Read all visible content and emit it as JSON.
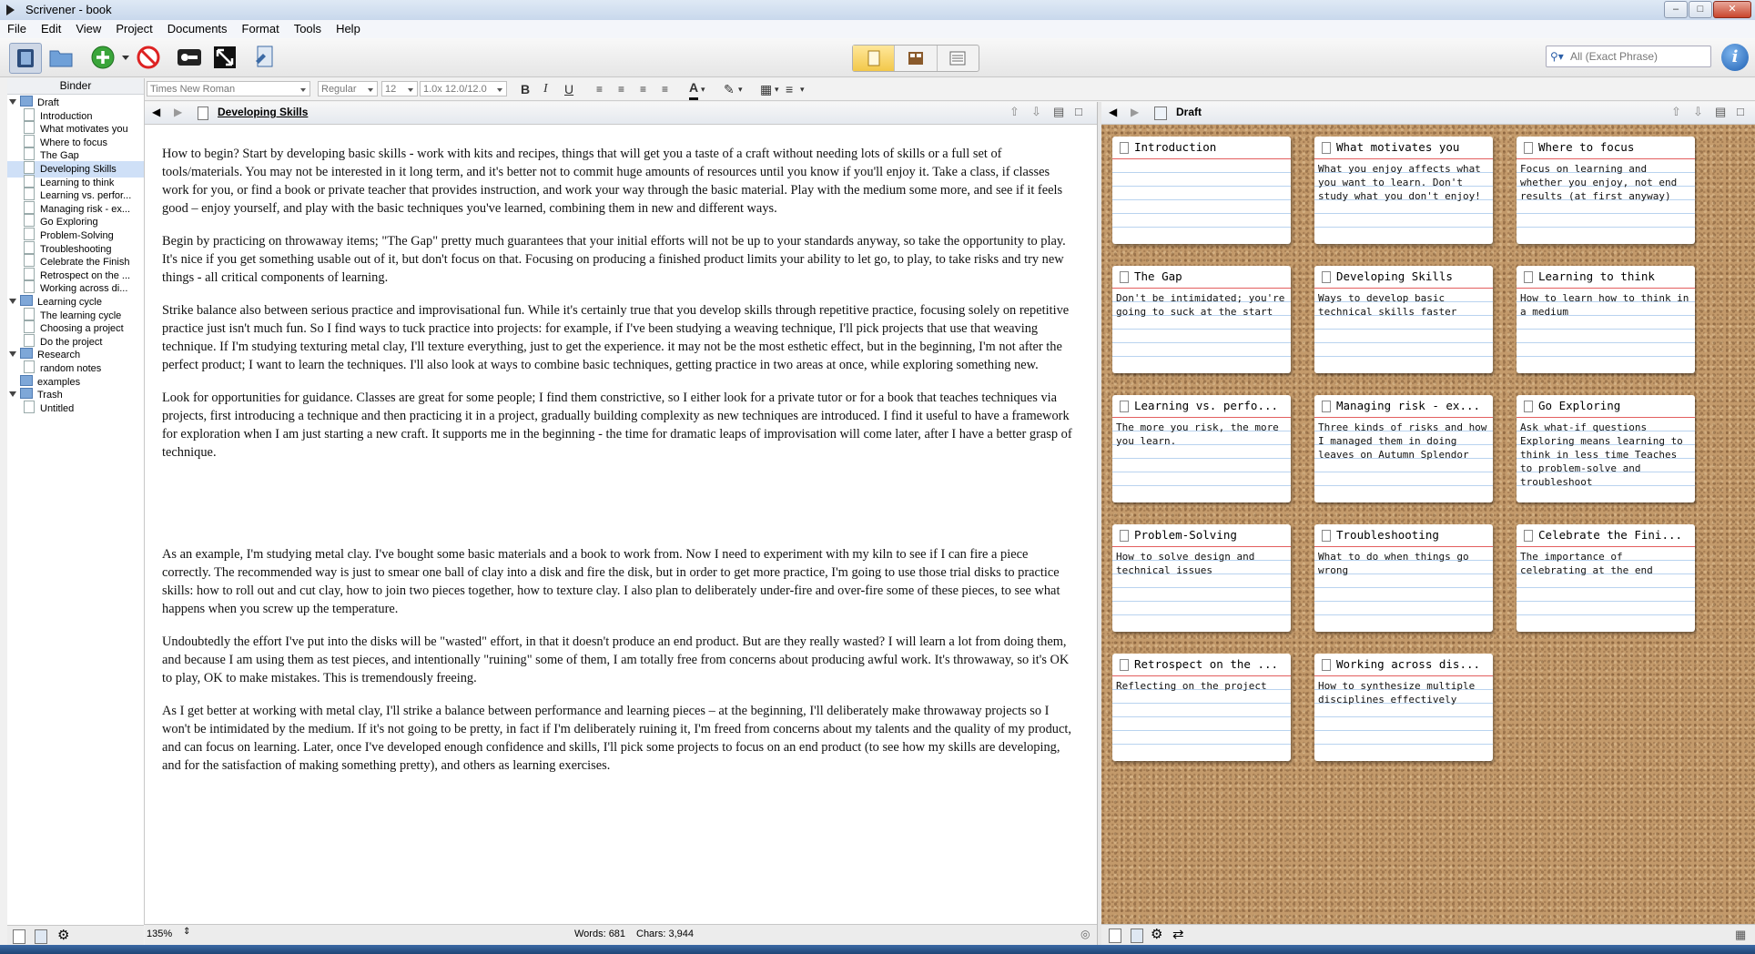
{
  "window": {
    "title": "Scrivener - book"
  },
  "menu": [
    "File",
    "Edit",
    "View",
    "Project",
    "Documents",
    "Format",
    "Tools",
    "Help"
  ],
  "search": {
    "placeholder": "All (Exact Phrase)"
  },
  "binder": {
    "header": "Binder",
    "items": [
      {
        "label": "Draft",
        "level": 0,
        "kind": "draft",
        "expanded": true
      },
      {
        "label": "Introduction",
        "level": 1,
        "kind": "doc"
      },
      {
        "label": "What motivates you",
        "level": 1,
        "kind": "doc"
      },
      {
        "label": "Where to focus",
        "level": 1,
        "kind": "doc"
      },
      {
        "label": "The Gap",
        "level": 1,
        "kind": "doc"
      },
      {
        "label": "Developing Skills",
        "level": 1,
        "kind": "doc",
        "selected": true
      },
      {
        "label": "Learning to think",
        "level": 1,
        "kind": "doc"
      },
      {
        "label": "Learning vs. perfor...",
        "level": 1,
        "kind": "doc"
      },
      {
        "label": "Managing risk - ex...",
        "level": 1,
        "kind": "doc"
      },
      {
        "label": "Go Exploring",
        "level": 1,
        "kind": "doc"
      },
      {
        "label": "Problem-Solving",
        "level": 1,
        "kind": "doc"
      },
      {
        "label": "Troubleshooting",
        "level": 1,
        "kind": "doc"
      },
      {
        "label": "Celebrate the Finish",
        "level": 1,
        "kind": "doc"
      },
      {
        "label": "Retrospect on the ...",
        "level": 1,
        "kind": "doc"
      },
      {
        "label": "Working across di...",
        "level": 1,
        "kind": "doc"
      },
      {
        "label": "Learning cycle",
        "level": 0,
        "kind": "folder",
        "expanded": true
      },
      {
        "label": "The learning cycle",
        "level": 1,
        "kind": "doc"
      },
      {
        "label": "Choosing a project",
        "level": 1,
        "kind": "doc"
      },
      {
        "label": "Do the project",
        "level": 1,
        "kind": "doc"
      },
      {
        "label": "Research",
        "level": 0,
        "kind": "folder",
        "expanded": true
      },
      {
        "label": "random notes",
        "level": 1,
        "kind": "doc"
      },
      {
        "label": "examples",
        "level": 0,
        "kind": "folder"
      },
      {
        "label": "Trash",
        "level": 0,
        "kind": "trash",
        "expanded": true
      },
      {
        "label": "Untitled",
        "level": 1,
        "kind": "doc"
      }
    ]
  },
  "format": {
    "font": "Times New Roman",
    "style": "Regular",
    "size": "12",
    "spacing": "1.0x 12.0/12.0"
  },
  "editor": {
    "doc_title": "Developing Skills",
    "paragraphs": [
      "How to begin?  Start by developing basic skills - work with kits and recipes, things that will get you a taste of a craft without needing lots of skills or a full set of tools/materials.    You may not be interested in it long term, and it's better not to commit huge amounts of resources until you know if you'll enjoy it.    Take a class, if classes work for you, or find a book or private teacher that provides instruction, and work your way through the basic material.  Play with the medium some more, and see if it feels good – enjoy yourself, and play with the basic techniques you've learned, combining them in new and different ways.",
      "Begin by practicing on throwaway items; \"The Gap\" pretty much guarantees that your initial efforts will not be up to your standards anyway, so take the opportunity to play.    It's nice if you get something usable out of it, but don't focus on that.    Focusing on producing a finished product limits your ability to let go, to play, to take risks and try new things - all critical components of learning.",
      "Strike balance also between serious practice and improvisational fun.    While it's certainly true that you develop skills through repetitive practice, focusing solely on repetitive practice just isn't much fun.    So I find ways to tuck practice into projects: for example, if I've been studying a weaving technique, I'll pick projects that use that weaving technique.    If I'm studying texturing metal clay, I'll texture everything, just to get the experience.    it may not be the most esthetic effect, but in the beginning, I'm not after the perfect product; I want to learn the techniques.    I'll also look at ways to combine basic techniques, getting practice in two areas at once, while exploring something new.",
      "Look for opportunities for guidance.    Classes are great for some people; I find them constrictive, so I either look for a private tutor or for a book that teaches techniques via projects, first introducing a technique and then practicing it in a project, gradually building complexity as new techniques are introduced.    I find it useful to have a framework for exploration when I am just starting a new craft.    It supports me in the beginning - the time for dramatic leaps of improvisation will come later, after I have a better grasp of technique.",
      "",
      "As an example, I'm studying metal clay.  I've bought some basic materials and a book to work from.    Now I need to experiment with my kiln to see if I can fire a piece correctly.    The recommended way is just to smear one ball of clay into a disk and fire the disk, but in order to get more practice, I'm going to use those trial disks to practice skills: how to roll out and cut clay, how to join two pieces together, how to texture clay.    I also plan to deliberately under-fire and over-fire some of these pieces, to see what happens when you screw up the temperature.",
      "Undoubtedly the effort I've put into the disks will be \"wasted\" effort, in that it doesn't produce an end product.    But are they really wasted?  I will learn a lot from doing them, and because I am using them as test pieces, and intentionally \"ruining\" some of them, I am totally free from concerns about producing awful work.    It's throwaway, so it's OK to play, OK to make mistakes.    This is tremendously freeing.",
      "As I get better at working with metal clay, I'll strike a balance between performance and learning pieces – at the beginning, I'll deliberately make throwaway projects so I won't be intimidated by the medium.  If it's not going to be pretty, in fact if I'm deliberately ruining it, I'm freed from concerns about my talents and the quality of my product, and can focus on learning.  Later, once I've developed enough confidence and skills, I'll pick some projects to focus on an end product (to see how my skills are developing, and for the satisfaction of making something pretty), and others as learning exercises."
    ],
    "zoom": "135%",
    "words": "Words: 681",
    "chars": "Chars: 3,944"
  },
  "corkboard": {
    "title": "Draft",
    "cards": [
      {
        "title": "Introduction",
        "synopsis": ""
      },
      {
        "title": "What motivates you",
        "synopsis": "What you enjoy affects what you want to learn. Don't study what you don't enjoy!"
      },
      {
        "title": "Where to focus",
        "synopsis": "Focus on learning and whether you enjoy, not end results (at first anyway)"
      },
      {
        "title": "The Gap",
        "synopsis": "Don't be intimidated; you're going to suck at the start"
      },
      {
        "title": "Developing Skills",
        "synopsis": "Ways to develop basic technical skills faster"
      },
      {
        "title": "Learning to think",
        "synopsis": "How to learn how to think in a medium"
      },
      {
        "title": "Learning vs. perfo...",
        "synopsis": "The more you risk, the more you learn."
      },
      {
        "title": "Managing risk - ex...",
        "synopsis": "Three kinds of risks and how I managed them in doing leaves on Autumn Splendor"
      },
      {
        "title": "Go Exploring",
        "synopsis": "Ask what-if questions Exploring means learning to think in less time Teaches to problem-solve and troubleshoot"
      },
      {
        "title": "Problem-Solving",
        "synopsis": "How to solve design and technical issues"
      },
      {
        "title": "Troubleshooting",
        "synopsis": "What to do when things go wrong"
      },
      {
        "title": "Celebrate the Fini...",
        "synopsis": "The importance of celebrating at the end"
      },
      {
        "title": "Retrospect on the ...",
        "synopsis": "Reflecting on the project"
      },
      {
        "title": "Working across dis...",
        "synopsis": "How to synthesize multiple disciplines effectively"
      }
    ]
  },
  "colors": {
    "selection": "#cfe0f7",
    "cork": "#c39a6b",
    "card_rule": "#e35e5e",
    "card_lines": "#b9d3ef",
    "active_mode": "#f2c84a"
  }
}
